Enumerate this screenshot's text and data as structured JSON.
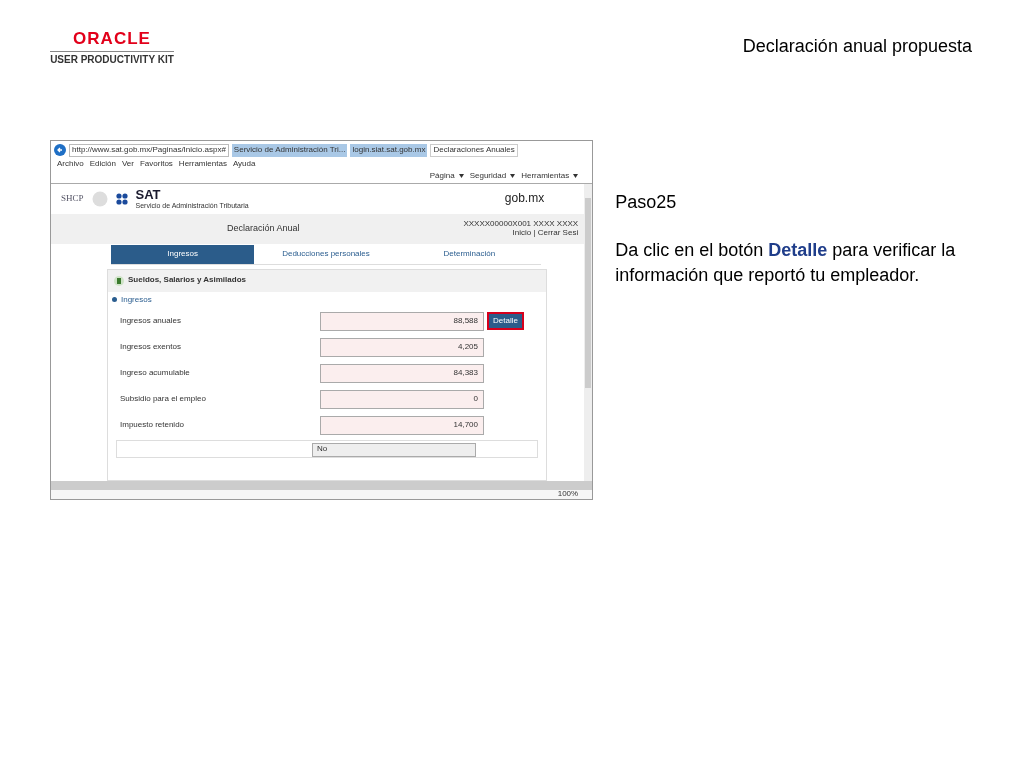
{
  "logo": {
    "brand": "ORACLE",
    "subtitle": "USER PRODUCTIVITY KIT"
  },
  "title": "Declaración anual propuesta",
  "browser": {
    "address": "http://www.sat.gob.mx/Paginas/Inicio.aspx#",
    "tabs": [
      {
        "label": "Servicio de Administración Tri...",
        "selected": false
      },
      {
        "label": "login.siat.sat.gob.mx",
        "selected": false
      },
      {
        "label": "Declaraciones Anuales",
        "selected": true
      }
    ],
    "menu": [
      "Archivo",
      "Edición",
      "Ver",
      "Favoritos",
      "Herramientas",
      "Ayuda"
    ],
    "commands": [
      "Página",
      "Seguridad",
      "Herramientas"
    ],
    "zoom": "100%"
  },
  "site": {
    "agency": "SHCP",
    "brand": "SAT",
    "brand_sub": "Servicio de Administración Tributaria",
    "gov": "gob.mx",
    "heading": "Declaración Anual",
    "user": "XXXXX00000X001 XXXX XXXX",
    "links": "Inicio | Cerrar Sesi",
    "tabs": [
      {
        "label": "Ingresos",
        "selected": true
      },
      {
        "label": "Deducciones personales",
        "selected": false
      },
      {
        "label": "Determinación",
        "selected": false
      }
    ],
    "section": "Sueldos, Salarios y Asimilados",
    "group": "Ingresos",
    "fields": [
      {
        "label": "Ingresos anuales",
        "value": "88,588",
        "button": "Detalle",
        "highlighted": true
      },
      {
        "label": "Ingresos exentos",
        "value": "4,205"
      },
      {
        "label": "Ingreso acumulable",
        "value": "84,383"
      },
      {
        "label": "Subsidio para el empleo",
        "value": "0"
      },
      {
        "label": "Impuesto retenido",
        "value": "14,700"
      }
    ],
    "select": "No"
  },
  "step": "Paso25",
  "instruction": "Da clic en el botón **Detalle** para verificar la información que reportó tu empleador."
}
